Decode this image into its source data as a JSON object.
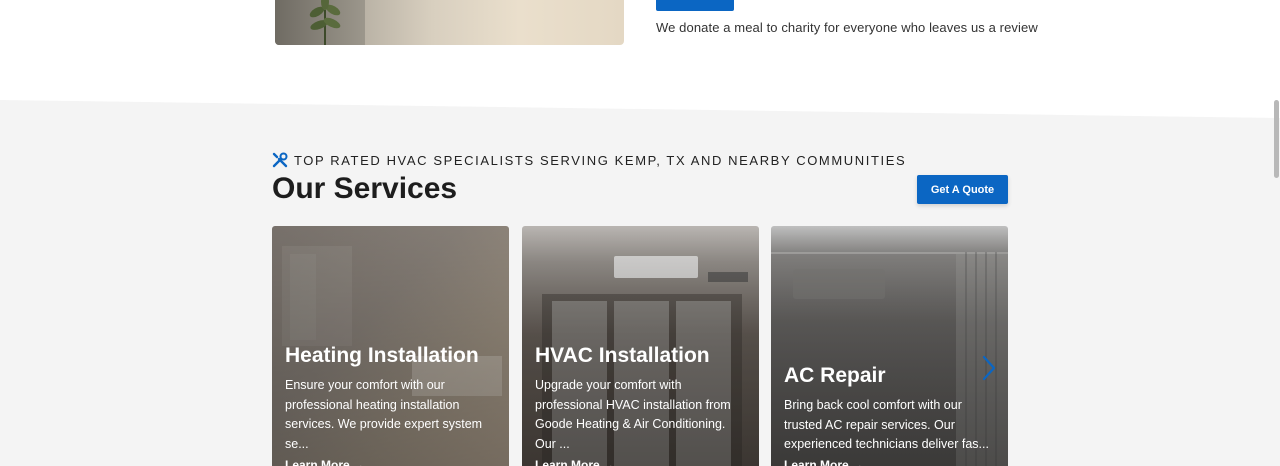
{
  "top": {
    "text": "We donate a meal to charity for everyone who leaves us a review"
  },
  "services": {
    "eyebrow": "TOP RATED HVAC SPECIALISTS SERVING KEMP, TX AND NEARBY COMMUNITIES",
    "title": "Our Services",
    "quote_button": "Get A Quote",
    "cards": [
      {
        "title": "Heating Installation",
        "description": "Ensure your comfort with our professional heating installation services. We provide expert system se...",
        "more": "Learn More →"
      },
      {
        "title": "HVAC Installation",
        "description": "Upgrade your comfort with professional HVAC installation from Goode Heating & Air Conditioning. Our ...",
        "more": "Learn More →"
      },
      {
        "title": "AC Repair",
        "description": "Bring back cool comfort with our trusted AC repair services. Our experienced technicians deliver fas...",
        "more": "Learn More →"
      }
    ]
  },
  "icons": {
    "eyebrow_icon": "tools-icon",
    "carousel_next": "chevron-right-icon"
  },
  "colors": {
    "accent": "#0b66c3",
    "section_bg": "#f4f4f4"
  }
}
